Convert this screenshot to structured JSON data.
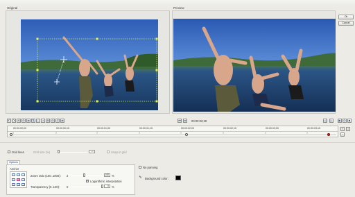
{
  "panels": {
    "original_label": "Original",
    "preview_label": "Preview"
  },
  "dialog_buttons": {
    "ok": "Ok",
    "cancel": "Cancel"
  },
  "transport": {
    "timecode": "00:00:02;29"
  },
  "timeline": {
    "ticks": [
      "00:00:00;00",
      "00:00:00;15",
      "00:00:01;00",
      "00:00:01;15",
      "00:00:02;00",
      "00:00:02;15",
      "00:00:03;00",
      "00:00:03;15"
    ]
  },
  "grid": {
    "grid_lines_label": "Grid lines",
    "snap_label": "Snap to grid",
    "grid_size_label": "Grid size (%)",
    "grid_size_value": "10"
  },
  "options": {
    "tab_label": "Options",
    "anchor_label": "Anchor",
    "zoom_label": "Zoom ratio (100..1000):",
    "zoom_value": "140",
    "zoom_unit": "%",
    "zoom_min": "2",
    "log_interp_label": "Logarithmic interpolation",
    "log_interp_checked": true,
    "transparency_label": "Transparency (0..100):",
    "transparency_value": "0",
    "transparency_unit": "%",
    "transparency_min": "0",
    "no_panning_label": "No panning",
    "no_panning_checked": false,
    "bg_color_label": "Background color:",
    "bg_color": "#000000"
  },
  "colors": {
    "accent": "#1a3f8a",
    "keyframe": "#cc2222"
  }
}
